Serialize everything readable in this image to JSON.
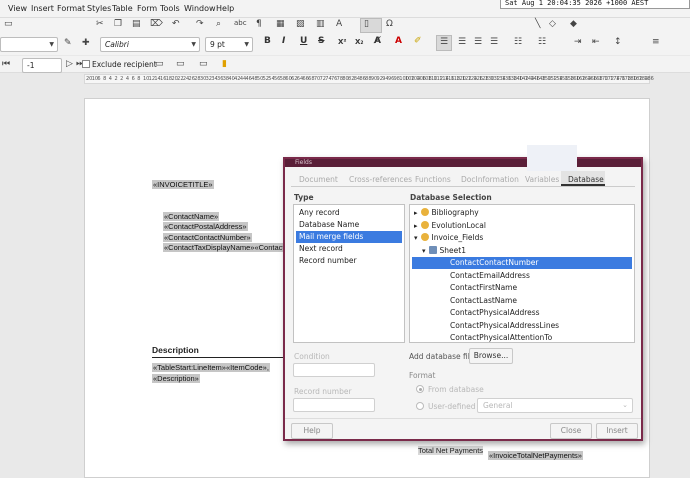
{
  "menubar": {
    "items": [
      "View",
      "Insert",
      "Format",
      "Styles",
      "Table",
      "Form",
      "Tools",
      "Window",
      "Help"
    ],
    "clock": "Sat Aug  1 20:04:35 2026 +1000 AEST"
  },
  "formatting": {
    "font_name": "Calibri",
    "font_size": "9 pt"
  },
  "mailmerge": {
    "record": "-1",
    "exclude_label": "Exclude recipient"
  },
  "ruler": {
    "marks": [
      "20",
      "10",
      "6",
      "8",
      "4",
      "2",
      "2",
      "4",
      "6",
      "8",
      "10",
      "12",
      "14",
      "16",
      "18",
      "20",
      "22",
      "24",
      "26",
      "28",
      "30",
      "32",
      "34",
      "36",
      "38",
      "40",
      "42",
      "44",
      "46",
      "48",
      "50",
      "52",
      "54",
      "56",
      "58",
      "60",
      "62",
      "64",
      "66",
      "68",
      "70",
      "72",
      "74",
      "76",
      "78",
      "80",
      "82",
      "84",
      "86",
      "88",
      "90",
      "92",
      "94",
      "96",
      "98",
      "100",
      "102",
      "104",
      "106",
      "108",
      "110",
      "112",
      "114",
      "116",
      "118",
      "120",
      "122",
      "124",
      "126",
      "128",
      "130",
      "132",
      "134",
      "136",
      "138",
      "140",
      "142",
      "144",
      "146",
      "148",
      "150",
      "152",
      "154",
      "156",
      "158",
      "160",
      "162",
      "164",
      "166",
      "168",
      "170",
      "172",
      "174",
      "176",
      "178",
      "180",
      "182",
      "184",
      "186"
    ]
  },
  "document": {
    "invoice_title": "«INVOICETITLE»",
    "contact_lines": [
      "«ContactName»",
      "«ContactPostalAddress»",
      "«ContactContactNumber»",
      "«ContactTaxDisplayName»«Contact"
    ],
    "description_heading": "Description",
    "table_line1": "«TableStart:LineItem»«ItemCode»,",
    "table_line2": "«Description»",
    "total_label": "Total Net Payments",
    "total_field": "«InvoiceTotalNetPayments»"
  },
  "dialog": {
    "title": "Fields",
    "tabs": [
      "Document",
      "Cross-references",
      "Functions",
      "DocInformation",
      "Variables",
      "Database"
    ],
    "active_tab": "Database",
    "type_label": "Type",
    "type_items": [
      "Any record",
      "Database Name",
      "Mail merge fields",
      "Next record",
      "Record number"
    ],
    "type_selected": "Mail merge fields",
    "db_selection_label": "Database Selection",
    "tree": [
      {
        "label": "Bibliography",
        "level": 0,
        "expander": "▸"
      },
      {
        "label": "EvolutionLocal",
        "level": 0,
        "expander": "▸"
      },
      {
        "label": "Invoice_Fields",
        "level": 0,
        "expander": "▾"
      },
      {
        "label": "Sheet1",
        "level": 1,
        "expander": "▾"
      },
      {
        "label": "ContactContactNumber",
        "level": 2,
        "expander": ""
      },
      {
        "label": "ContactEmailAddress",
        "level": 2,
        "expander": ""
      },
      {
        "label": "ContactFirstName",
        "level": 2,
        "expander": ""
      },
      {
        "label": "ContactLastName",
        "level": 2,
        "expander": ""
      },
      {
        "label": "ContactPhysicalAddress",
        "level": 2,
        "expander": ""
      },
      {
        "label": "ContactPhysicalAddressLines",
        "level": 2,
        "expander": ""
      },
      {
        "label": "ContactPhysicalAttentionTo",
        "level": 2,
        "expander": ""
      }
    ],
    "tree_selected": "ContactContactNumber",
    "condition_label": "Condition",
    "record_number_label": "Record number",
    "add_db_label": "Add database file",
    "browse_label": "Browse...",
    "format_label": "Format",
    "from_db_label": "From database",
    "user_defined_label": "User-defined",
    "format_value": "General",
    "help_label": "Help",
    "close_label": "Close",
    "insert_label": "Insert"
  },
  "colors": {
    "selection": "#3b7be0",
    "dialog_border": "#7a2a4a",
    "field_shade": "#c6c6c6"
  }
}
